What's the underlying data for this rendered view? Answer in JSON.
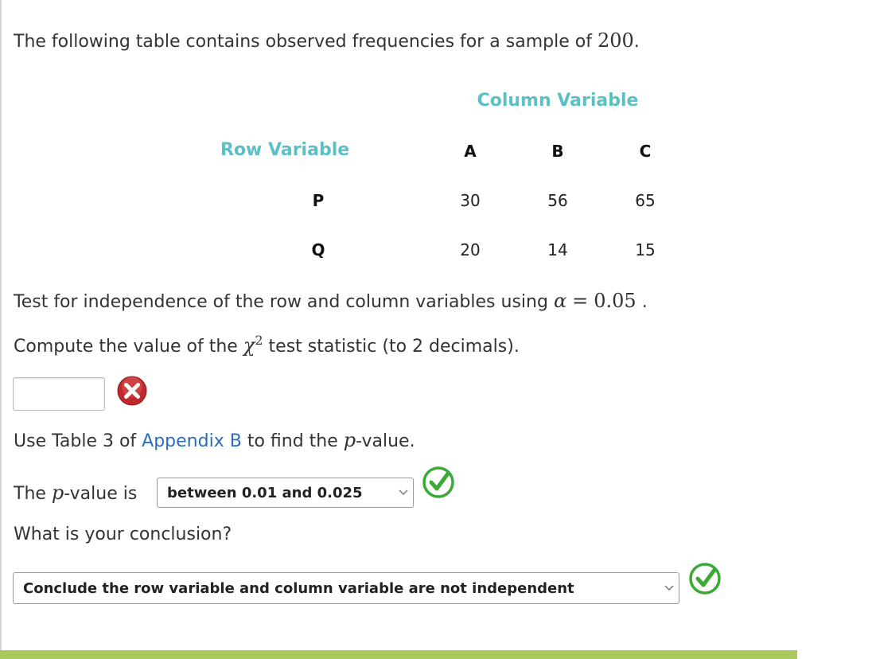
{
  "intro": {
    "text": "The following table contains observed frequencies for a sample of",
    "sample_size": "200",
    "period": "."
  },
  "table": {
    "column_variable_label": "Column Variable",
    "row_variable_label": "Row Variable",
    "column_headers": [
      "A",
      "B",
      "C"
    ],
    "rows": [
      {
        "label": "P",
        "values": [
          "30",
          "56",
          "65"
        ]
      },
      {
        "label": "Q",
        "values": [
          "20",
          "14",
          "15"
        ]
      }
    ]
  },
  "test": {
    "text": "Test for independence of the row and column variables using",
    "alpha_symbol": "α",
    "equals": "=",
    "alpha_value": "0.05",
    "period": "."
  },
  "compute": {
    "before": "Compute the value of the",
    "chi": "χ",
    "superscript": "2",
    "after": "test statistic (to 2 decimals)."
  },
  "answer_input": {
    "value": "",
    "status": "incorrect"
  },
  "table_ref": {
    "before": "Use Table 3 of",
    "link": "Appendix B",
    "middle": "to find the",
    "p": "p",
    "after": "-value."
  },
  "pvalue": {
    "before": "The",
    "p": "p",
    "after": "-value is",
    "selected": "between 0.01 and 0.025",
    "status": "correct"
  },
  "conclusion": {
    "question": "What is your conclusion?",
    "selected": "Conclude the row variable and column variable are not independent",
    "status": "correct"
  },
  "colors": {
    "accent_teal": "#5bc0c4",
    "link_blue": "#2a6ebb",
    "correct_green": "#3aa935",
    "incorrect_red": "#c0282d",
    "progress_bar": "#a9c95a"
  }
}
